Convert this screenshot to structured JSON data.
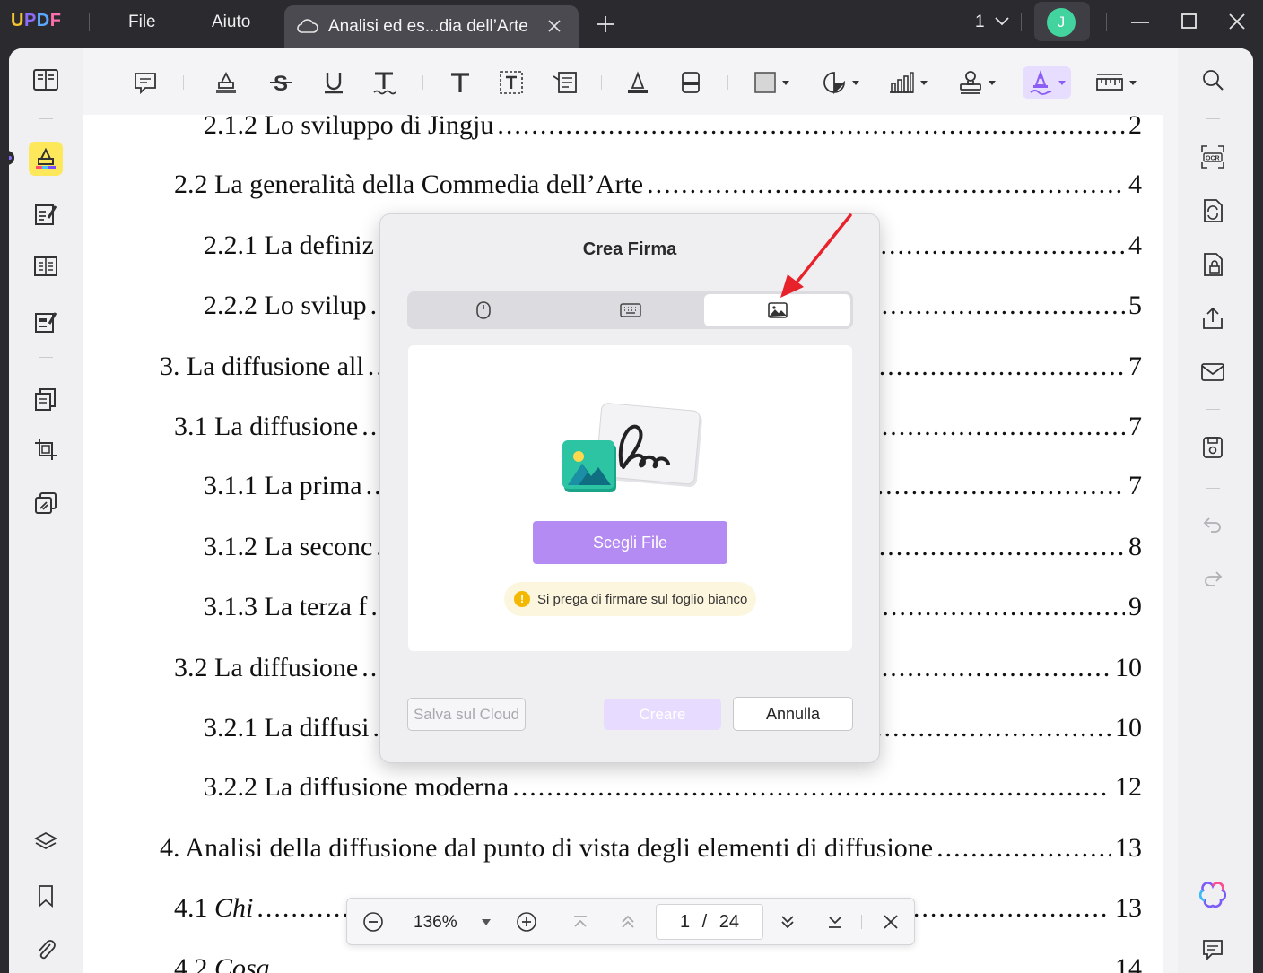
{
  "app": {
    "logo": "UPDF",
    "menu": [
      "File",
      "Aiuto"
    ],
    "tab_title": "Analisi ed es...dia dell’Arte",
    "page_indicator": "1",
    "avatar_initial": "J"
  },
  "toolbar": {
    "tools": [
      "comment-icon",
      "highlight-icon",
      "strikethrough-icon",
      "underline-icon",
      "squiggly-icon",
      "text-icon",
      "textbox-icon",
      "text-callout-icon",
      "pencil-icon",
      "eraser-icon",
      "shape-icon",
      "sticker-icon",
      "measure-chart-icon",
      "stamp-icon",
      "signature-icon",
      "ruler-icon"
    ],
    "active_tool": "signature-icon",
    "active_color": "#8b5cf6"
  },
  "document": {
    "entries": [
      {
        "label": "2.1.2 Lo sviluppo di Jingju",
        "page": "2"
      },
      {
        "label": "2.2 La generalità della Commedia dell’Arte",
        "page": "4"
      },
      {
        "label": "2.2.1 La definiz",
        "page": "4"
      },
      {
        "label": "2.2.2 Lo svilup",
        "page": "5"
      },
      {
        "label": "3. La diffusione all",
        "page": "7"
      },
      {
        "label": "3.1 La diffusione",
        "page": "7"
      },
      {
        "label": "3.1.1 La prima",
        "page": "7"
      },
      {
        "label": "3.1.2 La seconc",
        "page": "8"
      },
      {
        "label": "3.1.3 La terza f",
        "page": "9"
      },
      {
        "label": "3.2 La diffusione",
        "page": "10"
      },
      {
        "label": "3.2.1 La diffusi",
        "page": "10"
      },
      {
        "label": "3.2.2 La diffusione moderna",
        "page": "12"
      },
      {
        "label": "4. Analisi della diffusione dal punto di vista degli elementi di diffusione",
        "page": "13"
      },
      {
        "label_prefix": "4.1 ",
        "label_italic": "Chi",
        "page": "13"
      },
      {
        "label_prefix": "4.2 ",
        "label_italic": "Cosa",
        "page": "14"
      }
    ]
  },
  "dialog": {
    "title": "Crea Firma",
    "tabs": [
      "mouse-icon",
      "keyboard-icon",
      "image-icon"
    ],
    "selected_tab": "image-icon",
    "choose_file": "Scegli File",
    "hint": "Si prega di firmare sul foglio bianco",
    "save_cloud": "Salva sul Cloud",
    "create": "Creare",
    "cancel": "Annulla"
  },
  "zoombar": {
    "zoom": "136%",
    "current_page": "1",
    "separator": "/",
    "total_pages": "24"
  },
  "colors": {
    "accent": "#b48af3",
    "highlight_tool": "#fce85a",
    "arrow": "#e8222b"
  }
}
